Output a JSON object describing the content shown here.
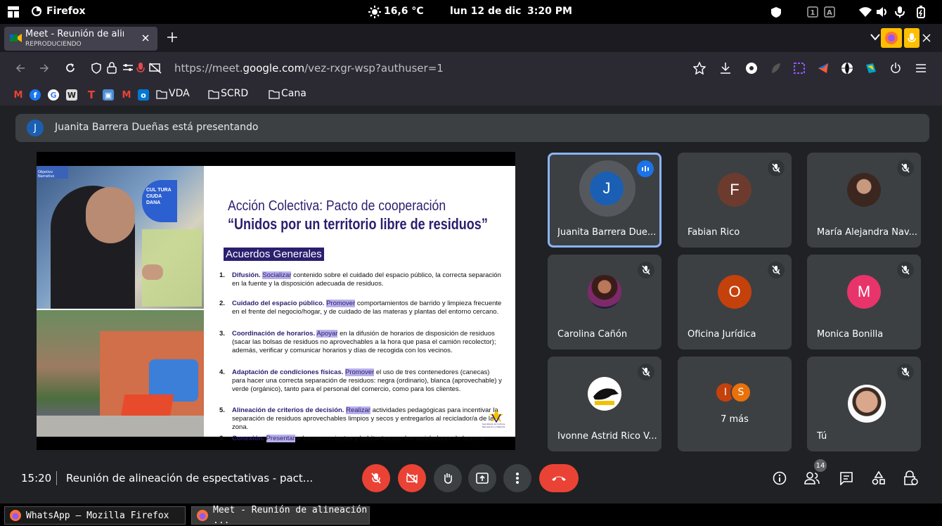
{
  "system_bar": {
    "app_name": "Firefox",
    "weather": "16,6 °C",
    "date": "lun 12 de dic",
    "time": "3:20 PM"
  },
  "browser": {
    "tab_title": "Meet - Reunión de alineac",
    "tab_status": "REPRODUCIENDO",
    "url_prefix": "https://meet.",
    "url_domain": "google.com",
    "url_suffix": "/vez-rxgr-wsp?authuser=1"
  },
  "bookmarks": {
    "folders": [
      "VDA",
      "SCRD",
      "Cana"
    ]
  },
  "meet": {
    "presenting_banner": {
      "initial": "J",
      "text": "Juanita Barrera Dueñas está presentando"
    },
    "slide": {
      "badge": "Objetivo Narrativo",
      "building_text": "CUL TURA CIUDA DANA",
      "title_line1": "Acción Colectiva: Pacto de cooperación",
      "title_line2": "“Unidos por un territorio libre de residuos”",
      "section": "Acuerdos Generales",
      "items": [
        {
          "num": "1.",
          "head": "Difusión.",
          "hl": "Socializar",
          "rest": " contenido sobre el cuidado del espacio público, la correcta separación en la fuente y la disposición adecuada de residuos."
        },
        {
          "num": "2.",
          "head": "Cuidado del espacio público.",
          "hl": "Promover",
          "rest": " comportamientos de barrido y limpieza frecuente en el frente del negocio/hogar, y de cuidado de las materas y plantas del entorno cercano."
        },
        {
          "num": "3.",
          "head": "Coordinación de horarios.",
          "hl": "Apoyar",
          "rest": " en la difusión de horarios de disposición de residuos (sacar las bolsas de residuos no aprovechables a la hora que pasa el camión recolector); además, verificar y comunicar horarios y días de recogida con los vecinos."
        },
        {
          "num": "4.",
          "head": "Adaptación de condiciones físicas.",
          "hl": "Promover",
          "rest": " el uso de tres contenedores (canecas) para hacer una correcta separación de residuos: negra (ordinario), blanca (aprovechable) y verde (orgánico), tanto para el personal del comercio, como para los clientes."
        },
        {
          "num": "5.",
          "head": "Alineación de criterios de decisión.",
          "hl": "Realizar",
          "rest": " actividades pedagógicas para incentivar la separación de residuos aprovechables limpios y secos y entregarlos al reciclador/a de la zona."
        },
        {
          "num": "6.",
          "head": "Conexión.",
          "hl": "Presentar",
          "rest": " a los comerciantes y habitantes con los recicladores de la zona."
        }
      ],
      "logo_text": "Secretaría de Cultura, Recreación y Deporte"
    },
    "participants": [
      {
        "name": "Juanita Barrera Due...",
        "initial": "J",
        "color": "#1a5fb4"
      },
      {
        "name": "Fabian Rico",
        "initial": "F",
        "color": "#6d3b2e"
      },
      {
        "name": "María Alejandra Nav...",
        "initial": "",
        "color": ""
      },
      {
        "name": "Carolina Cañón",
        "initial": "",
        "color": ""
      },
      {
        "name": "Oficina Jurídica",
        "initial": "O",
        "color": "#c4410c"
      },
      {
        "name": "Monica Bonilla",
        "initial": "M",
        "color": "#e8336b"
      },
      {
        "name": "Ivonne Astrid Rico V...",
        "initial": "",
        "color": ""
      },
      {
        "name": "7 más",
        "initial": "",
        "color": ""
      },
      {
        "name": "Tú",
        "initial": "",
        "color": ""
      }
    ],
    "more_initials": [
      "I",
      "S"
    ],
    "meeting_time": "15:20",
    "meeting_title": "Reunión de alineación de espectativas - pact...",
    "people_count": "14",
    "colors": {
      "red": "#ea4335",
      "active_border": "#8ab4f8",
      "tile": "#3c4043",
      "bg": "#202124"
    }
  },
  "taskbar": {
    "items": [
      "WhatsApp — Mozilla Firefox",
      "Meet - Reunión de alineación ..."
    ]
  }
}
